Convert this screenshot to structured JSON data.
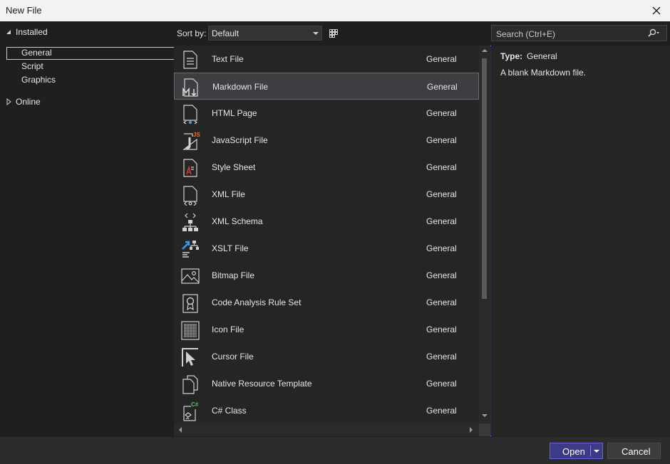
{
  "window": {
    "title": "New File"
  },
  "tree": {
    "installed": {
      "label": "Installed",
      "children": [
        {
          "label": "General"
        },
        {
          "label": "Script"
        },
        {
          "label": "Graphics"
        }
      ]
    },
    "online": {
      "label": "Online"
    }
  },
  "toolbar": {
    "sort_label": "Sort by:",
    "sort_value": "Default"
  },
  "search": {
    "placeholder": "Search (Ctrl+E)"
  },
  "templates": [
    {
      "name": "Text File",
      "category": "General",
      "icon": "text-file-icon"
    },
    {
      "name": "Markdown File",
      "category": "General",
      "icon": "markdown-file-icon"
    },
    {
      "name": "HTML Page",
      "category": "General",
      "icon": "html-page-icon"
    },
    {
      "name": "JavaScript File",
      "category": "General",
      "icon": "javascript-file-icon"
    },
    {
      "name": "Style Sheet",
      "category": "General",
      "icon": "style-sheet-icon"
    },
    {
      "name": "XML File",
      "category": "General",
      "icon": "xml-file-icon"
    },
    {
      "name": "XML Schema",
      "category": "General",
      "icon": "xml-schema-icon"
    },
    {
      "name": "XSLT File",
      "category": "General",
      "icon": "xslt-file-icon"
    },
    {
      "name": "Bitmap File",
      "category": "General",
      "icon": "bitmap-file-icon"
    },
    {
      "name": "Code Analysis Rule Set",
      "category": "General",
      "icon": "rule-set-icon"
    },
    {
      "name": "Icon File",
      "category": "General",
      "icon": "icon-file-icon"
    },
    {
      "name": "Cursor File",
      "category": "General",
      "icon": "cursor-file-icon"
    },
    {
      "name": "Native Resource Template",
      "category": "General",
      "icon": "resource-template-icon"
    },
    {
      "name": "C# Class",
      "category": "General",
      "icon": "csharp-class-icon"
    }
  ],
  "details": {
    "type_label": "Type:",
    "type_value": "General",
    "description": "A blank Markdown file."
  },
  "buttons": {
    "open": "Open",
    "cancel": "Cancel"
  },
  "colors": {
    "accent": "#3d3a8a",
    "list_bg": "#252526",
    "selected_row": "#3e3e42"
  }
}
